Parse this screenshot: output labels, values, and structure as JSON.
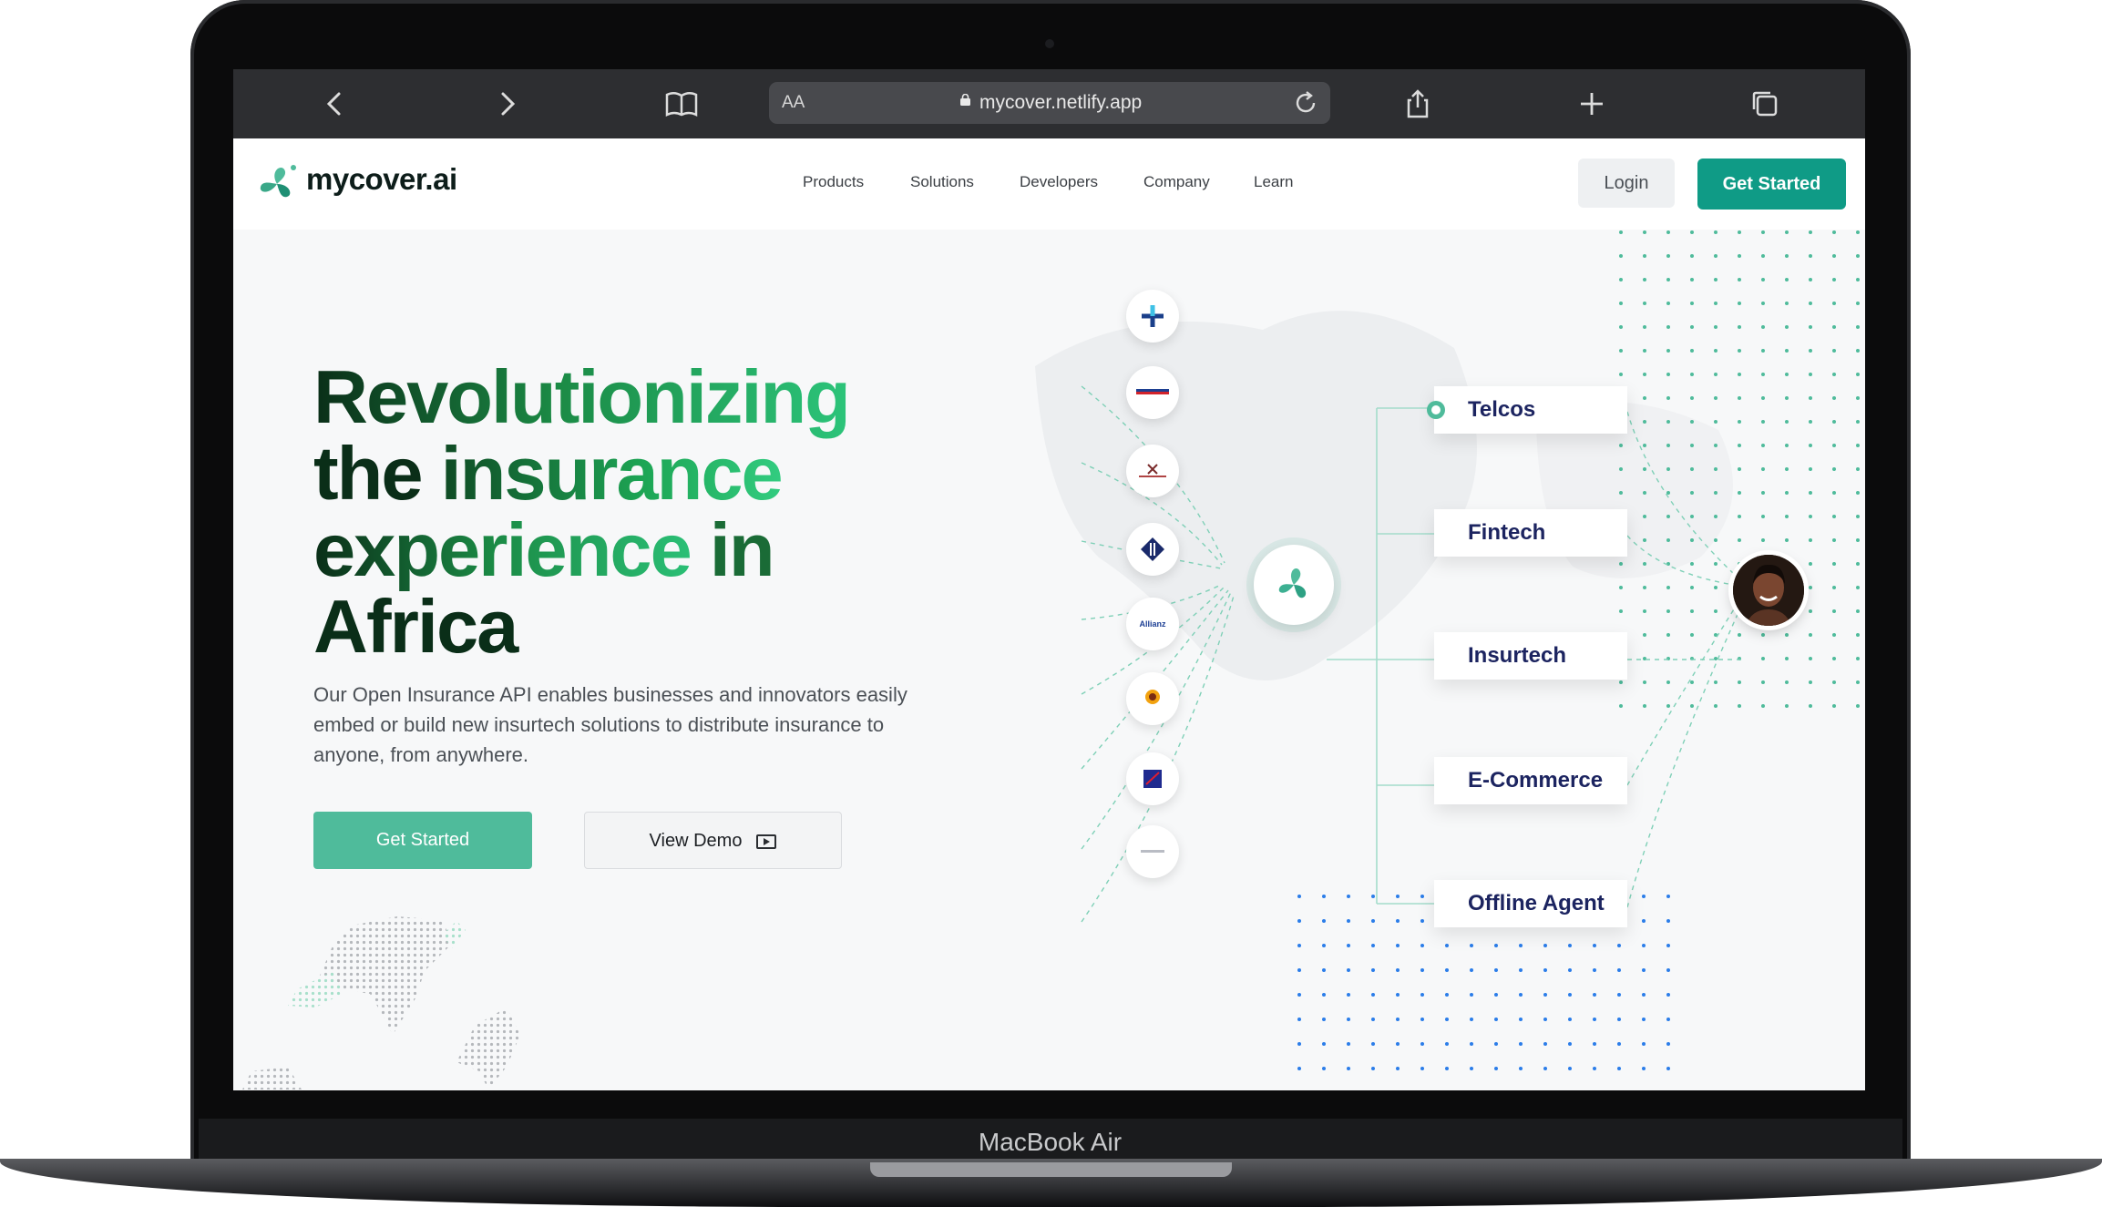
{
  "device": {
    "label": "MacBook Air"
  },
  "browser": {
    "text_size_label": "AA",
    "url": "mycover.netlify.app",
    "icons": [
      "chevron-left-icon",
      "chevron-right-icon",
      "bookmarks-icon",
      "share-icon",
      "plus-icon",
      "tabs-icon",
      "reload-icon",
      "lock-icon"
    ]
  },
  "nav": {
    "brand": "mycover.ai",
    "links": [
      "Products",
      "Solutions",
      "Developers",
      "Company",
      "Learn"
    ],
    "login": "Login",
    "get_started": "Get Started"
  },
  "hero": {
    "title_line1": "Revolutionizing",
    "title_line2_a": "the ",
    "title_line2_b": "insurance",
    "title_line3_a": "experience ",
    "title_line3_b": "in",
    "title_line4": "Africa",
    "description": "Our Open Insurance API enables businesses and innovators easily embed or build new insurtech solutions to distribute insurance to anyone, from anywhere.",
    "cta_primary": "Get Started",
    "cta_secondary": "View Demo"
  },
  "diagram": {
    "partner_logos": [
      "Allianz"
    ],
    "categories": [
      "Telcos",
      "Fintech",
      "Insurtech",
      "E-Commerce",
      "Offline Agent"
    ],
    "colors": {
      "accent": "#4fbb9b",
      "dots": "#4fbb9b",
      "dots_blue": "#2b7de9",
      "category_text": "#1c2460"
    }
  }
}
